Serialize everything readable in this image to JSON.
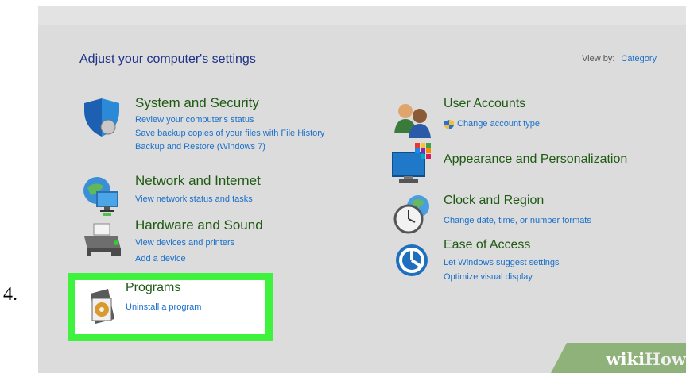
{
  "step_number": "4.",
  "header": {
    "title": "Adjust your computer's settings",
    "view_by_label": "View by:",
    "view_by_value": "Category"
  },
  "categories": [
    {
      "title": "System and Security",
      "icon": "shield-icon",
      "links": [
        "Review your computer's status",
        "Save backup copies of your files with File History",
        "Backup and Restore (Windows 7)"
      ]
    },
    {
      "title": "Network and Internet",
      "icon": "globe-network-icon",
      "links": [
        "View network status and tasks"
      ]
    },
    {
      "title": "Hardware and Sound",
      "icon": "printer-icon",
      "links": [
        "View devices and printers",
        "Add a device"
      ]
    },
    {
      "title": "Programs",
      "icon": "programs-disc-icon",
      "links": [
        "Uninstall a program"
      ]
    },
    {
      "title": "User Accounts",
      "icon": "users-icon",
      "links": [
        "Change account type"
      ]
    },
    {
      "title": "Appearance and Personalization",
      "icon": "monitor-palette-icon",
      "links": []
    },
    {
      "title": "Clock and Region",
      "icon": "clock-globe-icon",
      "links": [
        "Change date, time, or number formats"
      ]
    },
    {
      "title": "Ease of Access",
      "icon": "ease-of-access-icon",
      "links": [
        "Let Windows suggest settings",
        "Optimize visual display"
      ]
    }
  ],
  "highlight_color": "#3ef23e",
  "watermark": {
    "part1": "wiki",
    "part2": "How"
  }
}
